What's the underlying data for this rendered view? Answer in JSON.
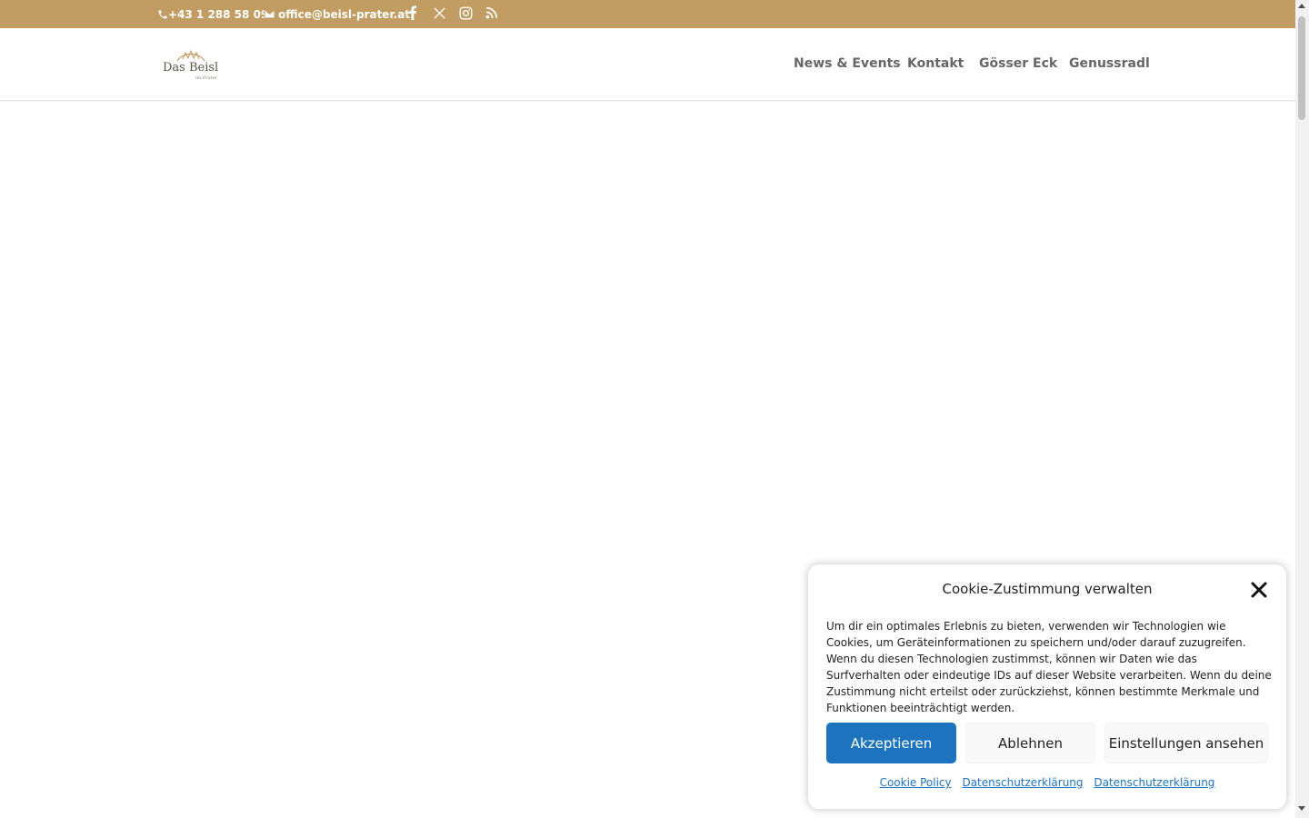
{
  "topbar": {
    "phone": "+43 1 288 58 09",
    "email": "office@beisl-prater.at",
    "phone_icon": "phone-icon",
    "email_icon": "email-icon",
    "social": [
      "facebook-icon",
      "x-icon",
      "instagram-icon",
      "rss-icon"
    ],
    "bg_color": "#c29d63"
  },
  "header": {
    "logo_text": "Das Beisl",
    "logo_sub": "im Prater",
    "nav": [
      "News & Events",
      "Kontakt",
      "Gösser Eck",
      "Genussradl"
    ]
  },
  "cookie": {
    "title": "Cookie-Zustimmung verwalten",
    "message": "Um dir ein optimales Erlebnis zu bieten, verwenden wir Technologien wie Cookies, um Geräteinformationen zu speichern und/oder darauf zuzugreifen. Wenn du diesen Technologien zustimmst, können wir Daten wie das Surfverhalten oder eindeutige IDs auf dieser Website verarbeiten. Wenn du deine Zustimmung nicht erteilst oder zurückziehst, können bestimmte Merkmale und Funktionen beeinträchtigt werden.",
    "accept_label": "Akzeptieren",
    "deny_label": "Ablehnen",
    "prefs_label": "Einstellungen ansehen",
    "links": [
      "Cookie Policy",
      "Datenschutzerklärung",
      "Datenschutzerklärung"
    ],
    "accent_color": "#1e73be"
  }
}
